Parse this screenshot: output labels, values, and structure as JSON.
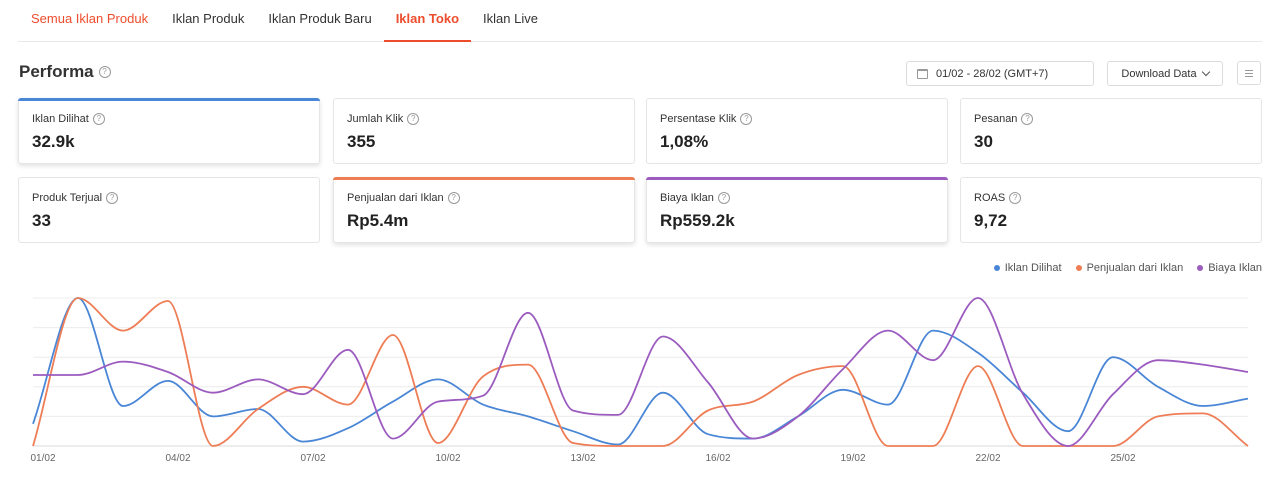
{
  "tabs": [
    {
      "label": "Semua Iklan Produk"
    },
    {
      "label": "Iklan Produk"
    },
    {
      "label": "Iklan Produk Baru"
    },
    {
      "label": "Iklan Toko"
    },
    {
      "label": "Iklan Live"
    }
  ],
  "performance": {
    "title": "Performa",
    "date_range": "01/02 - 28/02 (GMT+7)",
    "download_label": "Download Data"
  },
  "metrics": [
    {
      "label": "Iklan Dilihat",
      "value": "32.9k"
    },
    {
      "label": "Jumlah Klik",
      "value": "355"
    },
    {
      "label": "Persentase Klik",
      "value": "1,08%"
    },
    {
      "label": "Pesanan",
      "value": "30"
    },
    {
      "label": "Produk Terjual",
      "value": "33"
    },
    {
      "label": "Penjualan dari Iklan",
      "value": "Rp5.4m"
    },
    {
      "label": "Biaya Iklan",
      "value": "Rp559.2k"
    },
    {
      "label": "ROAS",
      "value": "9,72"
    }
  ],
  "colors": {
    "accent": "#ee4d2d",
    "iklan_dilihat": "#4a86d6",
    "penjualan": "#ee7d55",
    "biaya": "#9b5bbf"
  },
  "chart_data": {
    "type": "line",
    "x": [
      "01/02",
      "02/02",
      "03/02",
      "04/02",
      "05/02",
      "06/02",
      "07/02",
      "08/02",
      "09/02",
      "10/02",
      "11/02",
      "12/02",
      "13/02",
      "14/02",
      "15/02",
      "16/02",
      "17/02",
      "18/02",
      "19/02",
      "20/02",
      "21/02",
      "22/02",
      "23/02",
      "24/02",
      "25/02",
      "26/02",
      "27/02",
      "28/02"
    ],
    "xticks": [
      "01/02",
      "04/02",
      "07/02",
      "10/02",
      "13/02",
      "16/02",
      "19/02",
      "22/02",
      "25/02"
    ],
    "ylim": [
      0,
      100
    ],
    "legend_position": "top-right",
    "grid": true,
    "series": [
      {
        "name": "Iklan Dilihat",
        "color": "#4a86d6",
        "values": [
          15,
          100,
          27,
          44,
          20,
          25,
          3,
          12,
          30,
          45,
          28,
          20,
          10,
          1,
          36,
          8,
          5,
          20,
          38,
          28,
          78,
          63,
          36,
          10,
          60,
          40,
          27,
          32
        ]
      },
      {
        "name": "Penjualan dari Iklan",
        "color": "#ee7d55",
        "values": [
          0,
          100,
          78,
          98,
          0,
          25,
          40,
          28,
          75,
          2,
          47,
          55,
          2,
          0,
          0,
          24,
          30,
          48,
          54,
          0,
          0,
          54,
          0,
          0,
          0,
          20,
          22,
          0
        ]
      },
      {
        "name": "Biaya Iklan",
        "color": "#9b5bbf",
        "values": [
          48,
          48,
          57,
          50,
          36,
          45,
          35,
          65,
          5,
          30,
          34,
          90,
          24,
          21,
          74,
          43,
          5,
          20,
          52,
          78,
          58,
          100,
          35,
          0,
          35,
          58,
          55,
          50
        ]
      }
    ]
  }
}
